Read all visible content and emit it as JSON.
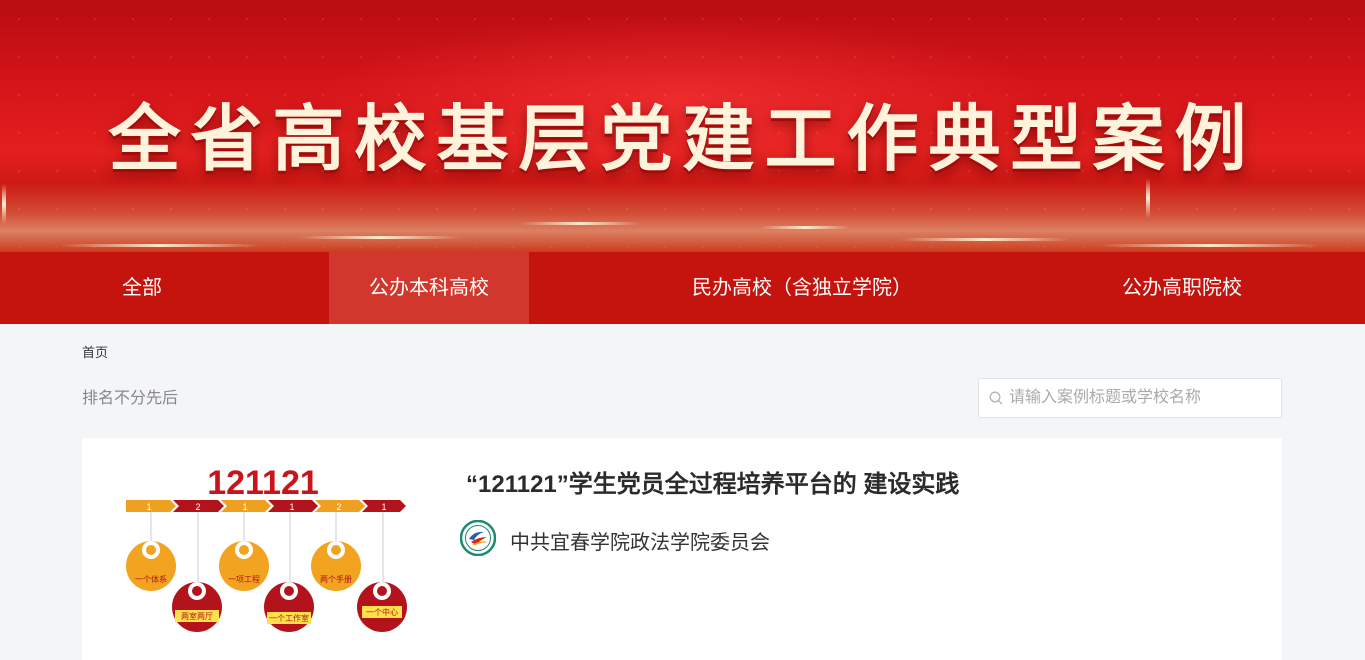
{
  "banner": {
    "title": "全省高校基层党建工作典型案例"
  },
  "nav": {
    "items": [
      {
        "label": "全部"
      },
      {
        "label": "公办本科高校",
        "active": true
      },
      {
        "label": "民办高校（含独立学院）"
      },
      {
        "label": "公办高职院校"
      }
    ]
  },
  "breadcrumb": {
    "home": "首页"
  },
  "rank_note": "排名不分先后",
  "search": {
    "placeholder": "请输入案例标题或学校名称",
    "icon": "search-icon"
  },
  "cases": [
    {
      "title": "“121121”学生党员全过程培养平台的 建设实践",
      "org": "中共宜春学院政法学院委员会",
      "thumbnail": {
        "heading": "121121",
        "steps": [
          "1",
          "2",
          "1",
          "1",
          "2",
          "1"
        ],
        "circles": [
          "一个体系",
          "两室两厅",
          "一项工程",
          "一个工作室",
          "两个手册",
          "一个中心"
        ]
      }
    }
  ],
  "colors": {
    "brand_red": "#c5140d",
    "nav_active": "#d2372e",
    "page_bg": "#f4f5f7"
  }
}
